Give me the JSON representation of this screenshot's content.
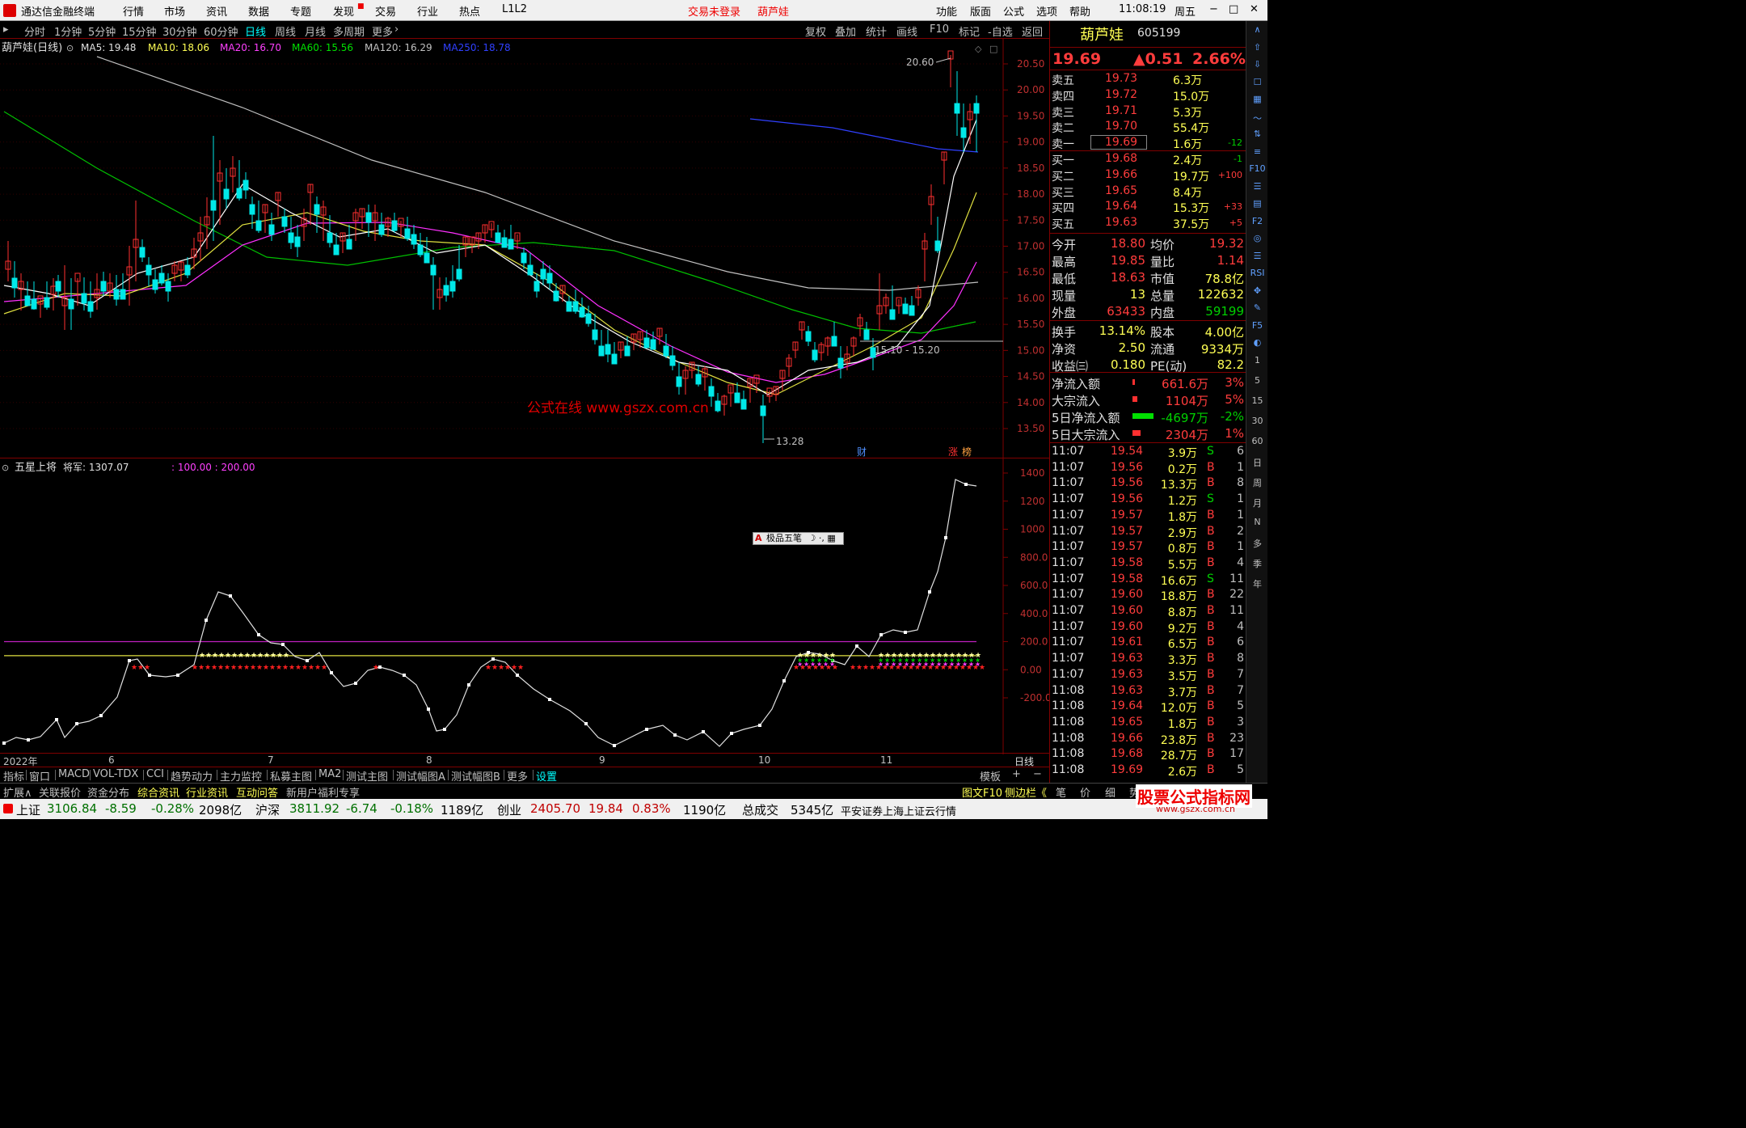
{
  "menubar": {
    "app_title": "通达信金融终端",
    "menus": [
      "行情",
      "市场",
      "资讯",
      "数据",
      "专题",
      "发现",
      "交易",
      "行业",
      "热点",
      "L1L2"
    ],
    "trade_status": "交易未登录",
    "stock_name": "葫芦娃",
    "right_menus": [
      "功能",
      "版面",
      "公式",
      "选项",
      "帮助"
    ],
    "time": "11:08:19",
    "weekday": "周五",
    "window_buttons": [
      "−",
      "□",
      "✕"
    ]
  },
  "periods": {
    "items": [
      "分时",
      "1分钟",
      "5分钟",
      "15分钟",
      "30分钟",
      "60分钟",
      "日线",
      "周线",
      "月线",
      "多周期",
      "更多"
    ],
    "active": "日线",
    "tools": [
      "复权",
      "叠加",
      "统计",
      "画线",
      "F10",
      "标记",
      "-自选",
      "返回"
    ]
  },
  "main": {
    "title": "葫芦娃(日线)",
    "ma5": "MA5: 19.48",
    "ma10": "MA10: 18.06",
    "ma20": "MA20: 16.70",
    "ma60": "MA60: 15.56",
    "ma120": "MA120: 16.29",
    "ma250": "MA250: 18.78",
    "high_label": "20.60",
    "low_label": "13.28",
    "range_label": "15.10 - 15.20",
    "watermark": "公式在线  www.gszx.com.cn",
    "marker_cai": "财",
    "marker_zhang": "涨",
    "marker_bang": "榜",
    "y_ticks": [
      "20.50",
      "20.00",
      "19.50",
      "19.00",
      "18.50",
      "18.00",
      "17.50",
      "17.00",
      "16.50",
      "16.00",
      "15.50",
      "15.00",
      "14.50",
      "14.00",
      "13.50"
    ]
  },
  "indicator": {
    "title": "五星上将",
    "value_label": "将军: 1307.07",
    "levels": ": 100.00 : 200.00",
    "y_ticks": [
      "1400",
      "1200",
      "1000",
      "800.0",
      "600.0",
      "400.0",
      "200.0",
      "0.00",
      "-200.0"
    ],
    "ime_label": "极品五笔"
  },
  "xaxis": {
    "labels": [
      "2022年",
      "6",
      "7",
      "8",
      "9",
      "10",
      "11"
    ],
    "period": "日线"
  },
  "quote": {
    "name": "葫芦娃",
    "code": "605199",
    "price": "19.69",
    "change": "▲0.51",
    "pct": "2.66%",
    "asks": [
      {
        "label": "卖五",
        "price": "19.73",
        "vol": "6.3万",
        "chg": ""
      },
      {
        "label": "卖四",
        "price": "19.72",
        "vol": "15.0万",
        "chg": ""
      },
      {
        "label": "卖三",
        "price": "19.71",
        "vol": "5.3万",
        "chg": ""
      },
      {
        "label": "卖二",
        "price": "19.70",
        "vol": "55.4万",
        "chg": ""
      },
      {
        "label": "卖一",
        "price": "19.69",
        "vol": "1.6万",
        "chg": "-12"
      }
    ],
    "bids": [
      {
        "label": "买一",
        "price": "19.68",
        "vol": "2.4万",
        "chg": "-1"
      },
      {
        "label": "买二",
        "price": "19.66",
        "vol": "19.7万",
        "chg": "+100"
      },
      {
        "label": "买三",
        "price": "19.65",
        "vol": "8.4万",
        "chg": ""
      },
      {
        "label": "买四",
        "price": "19.64",
        "vol": "15.3万",
        "chg": "+33"
      },
      {
        "label": "买五",
        "price": "19.63",
        "vol": "37.5万",
        "chg": "+5"
      }
    ],
    "stats": [
      [
        "今开",
        "18.80",
        "均价",
        "19.32"
      ],
      [
        "最高",
        "19.85",
        "量比",
        "1.14"
      ],
      [
        "最低",
        "18.63",
        "市值",
        "78.8亿"
      ],
      [
        "现量",
        "13",
        "总量",
        "122632"
      ],
      [
        "外盘",
        "63433",
        "内盘",
        "59199"
      ]
    ],
    "stats2": [
      [
        "换手",
        "13.14%",
        "股本",
        "4.00亿"
      ],
      [
        "净资",
        "2.50",
        "流通",
        "9334万"
      ],
      [
        "收益㈢",
        "0.180",
        "PE(动)",
        "82.2"
      ]
    ],
    "flows": [
      [
        "净流入额",
        "661.6万",
        "3%"
      ],
      [
        "大宗流入",
        "1104万",
        "5%"
      ],
      [
        "5日净流入额",
        "-4697万",
        "-2%"
      ],
      [
        "5日大宗流入",
        "2304万",
        "1%"
      ]
    ],
    "ticks": [
      [
        "11:07",
        "19.54",
        "3.9万",
        "S",
        "6"
      ],
      [
        "11:07",
        "19.56",
        "0.2万",
        "B",
        "1"
      ],
      [
        "11:07",
        "19.56",
        "13.3万",
        "B",
        "8"
      ],
      [
        "11:07",
        "19.56",
        "1.2万",
        "S",
        "1"
      ],
      [
        "11:07",
        "19.57",
        "1.8万",
        "B",
        "1"
      ],
      [
        "11:07",
        "19.57",
        "2.9万",
        "B",
        "2"
      ],
      [
        "11:07",
        "19.57",
        "0.8万",
        "B",
        "1"
      ],
      [
        "11:07",
        "19.58",
        "5.5万",
        "B",
        "4"
      ],
      [
        "11:07",
        "19.58",
        "16.6万",
        "S",
        "11"
      ],
      [
        "11:07",
        "19.60",
        "18.8万",
        "B",
        "22"
      ],
      [
        "11:07",
        "19.60",
        "8.8万",
        "B",
        "11"
      ],
      [
        "11:07",
        "19.60",
        "9.2万",
        "B",
        "4"
      ],
      [
        "11:07",
        "19.61",
        "6.5万",
        "B",
        "6"
      ],
      [
        "11:07",
        "19.63",
        "3.3万",
        "B",
        "8"
      ],
      [
        "11:07",
        "19.63",
        "3.5万",
        "B",
        "7"
      ],
      [
        "11:08",
        "19.63",
        "3.7万",
        "B",
        "7"
      ],
      [
        "11:08",
        "19.64",
        "12.0万",
        "B",
        "5"
      ],
      [
        "11:08",
        "19.65",
        "1.8万",
        "B",
        "3"
      ],
      [
        "11:08",
        "19.66",
        "23.8万",
        "B",
        "23"
      ],
      [
        "11:08",
        "19.68",
        "28.7万",
        "B",
        "17"
      ],
      [
        "11:08",
        "19.69",
        "2.6万",
        "B",
        "5"
      ]
    ]
  },
  "bottomtabs": {
    "items": [
      "指标",
      "窗口",
      "MACD",
      "VOL-TDX",
      "CCI",
      "趋势动力",
      "主力监控",
      "私募主图",
      "MA2",
      "测试主图",
      "测试幅图A",
      "测试幅图B",
      "更多",
      "设置"
    ],
    "right": [
      "模板",
      "+",
      "−"
    ]
  },
  "bar2": {
    "items": [
      "扩展∧",
      "关联报价",
      "资金分布",
      "综合资讯",
      "行业资讯",
      "互动问答",
      "新用户福利专享"
    ],
    "right": [
      "图文F10",
      "侧边栏《",
      "笔",
      "价",
      "细",
      "势"
    ]
  },
  "status": {
    "sh_label": "上证",
    "sh_val": "3106.84",
    "sh_chg": "-8.59",
    "sh_pct": "-0.28%",
    "sh_amt": "2098亿",
    "hs_label": "沪深",
    "hs_val": "3811.92",
    "hs_chg": "-6.74",
    "hs_pct": "-0.18%",
    "hs_amt": "1189亿",
    "cy_label": "创业",
    "cy_val": "2405.70",
    "cy_chg": "19.84",
    "cy_pct": "0.83%",
    "cy_amt": "1190亿",
    "total_label": "总成交",
    "total_amt": "5345亿",
    "broker": "平安证券上海上证云行情",
    "logo": "股票公式指标网",
    "logo_url": "www.gszx.com.cn"
  },
  "side_tools": [
    "∧",
    "⇧",
    "⇩",
    "☐",
    "▦",
    "〜",
    "⇅",
    "≡",
    "F10",
    "☰",
    "▤",
    "F2",
    "◎",
    "☰",
    "RSI",
    "✥",
    "✎",
    "F5",
    "◐",
    "1",
    "5",
    "15",
    "30",
    "60",
    "日",
    "周",
    "月",
    "N",
    "多",
    "季",
    "年"
  ]
}
